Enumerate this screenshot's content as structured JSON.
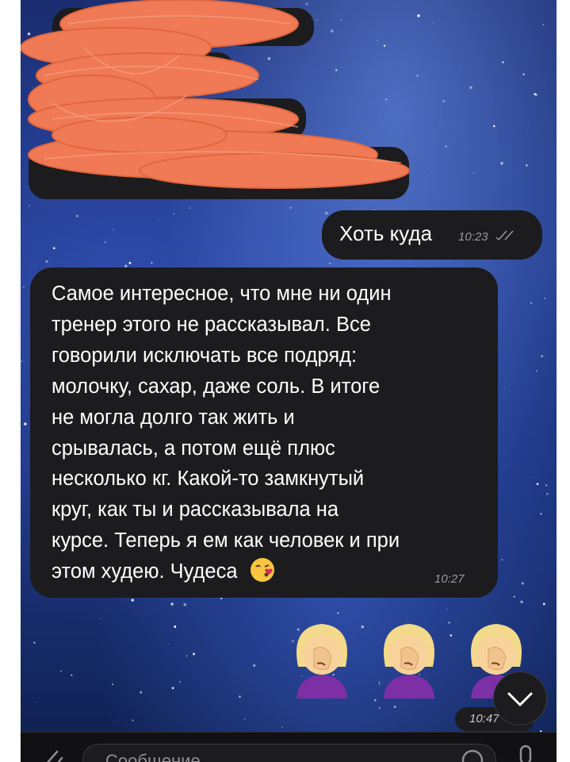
{
  "chat": {
    "outgoing_message": {
      "text": "Хоть куда",
      "time": "10:23"
    },
    "incoming_message": {
      "lines": [
        "Самое интересное, что мне ни один",
        "тренер этого не рассказывал. Все",
        "говорили исключать все подряд:",
        "молочку, сахар, даже соль. В итоге",
        "не могла долго так жить и",
        "срывалась, а потом ещё плюс",
        "несколько кг. Какой-то замкнутый",
        "круг, как ты и рассказывала на",
        "курсе. Теперь я ем как человек и при",
        "этом худею. Чудеса"
      ],
      "time": "10:27"
    },
    "sticker_time": "10:47",
    "sticker_emoji_name": "woman-facepalming",
    "sticker_count": 3
  },
  "input": {
    "placeholder": "Сообщение"
  },
  "colors": {
    "bubble": "#1c1c1e",
    "redaction": "#f07a55",
    "background": "#1d3580"
  }
}
